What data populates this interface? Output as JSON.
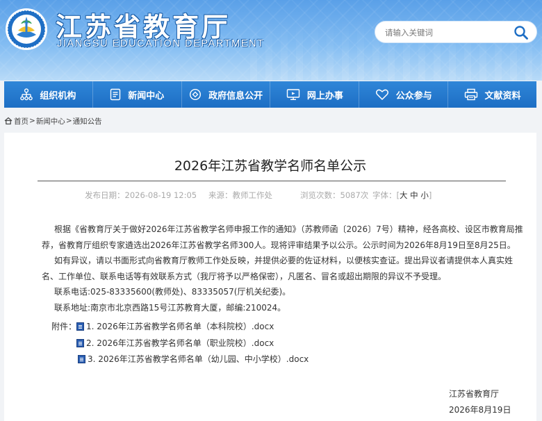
{
  "header": {
    "site_title": "江苏省教育厅",
    "site_subtitle": "JIANGSU EDUCATION DEPARTMENT",
    "search_placeholder": "请输入关键词",
    "brand_color": "#1d6ec4",
    "logo_icon": "jiangsu-education-emblem"
  },
  "nav": {
    "items": [
      {
        "label": "组织机构",
        "icon": "org-chart-icon"
      },
      {
        "label": "新闻中心",
        "icon": "news-doc-icon"
      },
      {
        "label": "政府信息公开",
        "icon": "info-disclosure-icon"
      },
      {
        "label": "网上办事",
        "icon": "monitor-icon"
      },
      {
        "label": "公众参与",
        "icon": "heart-icon"
      },
      {
        "label": "文献资料",
        "icon": "printer-icon"
      }
    ]
  },
  "breadcrumb": {
    "home": "首页",
    "sep": ">",
    "level1": "新闻中心",
    "level2": "通知公告"
  },
  "article": {
    "title": "2026年江苏省教学名师名单公示",
    "meta": {
      "date": "发布日期：2026-08-19 12:05",
      "source": "来源：教师工作处",
      "views": "浏览次数：5087次",
      "font_label": "字体：",
      "font_large": "大",
      "font_medium": "中",
      "font_small": "小"
    },
    "p1_line1": "根据《省教育厅关于做好2026年江苏省教学名师申报工作的通知》（苏教师函〔2026〕7号）精神，经各高校、设区市教育局推",
    "p1_line2": "荐，省教育厅组织专家遴选出2026年江苏省教学名师300人。现将评审结果予以公示。公示时间为2026年8月19日至8月25日。",
    "p2_line1": "如有异议，请以书面形式向省教育厅教师工作处反映，并提供必要的佐证材料，以便核实查证。提出异议者请提供本人真实姓",
    "p2_line2": "名、工作单位、联系电话等有效联系方式（我厅将予以严格保密），凡匿名、冒名或超出期限的异议不予受理。",
    "phone": "联系电话:025-83335600(教师处)、83335057(厅机关纪委)。",
    "address": "联系地址:南京市北京西路15号江苏教育大厦，邮编:210024。",
    "attachments_label": "附件：",
    "attachments": [
      "1. 2026年江苏省教学名师名单（本科院校）.docx",
      "2. 2026年江苏省教学名师名单（职业院校）.docx",
      "3. 2026年江苏省教学名师名单（幼儿园、中小学校）.docx"
    ],
    "signature": "江苏省教育厅",
    "sign_date": "2026年8月19日"
  }
}
